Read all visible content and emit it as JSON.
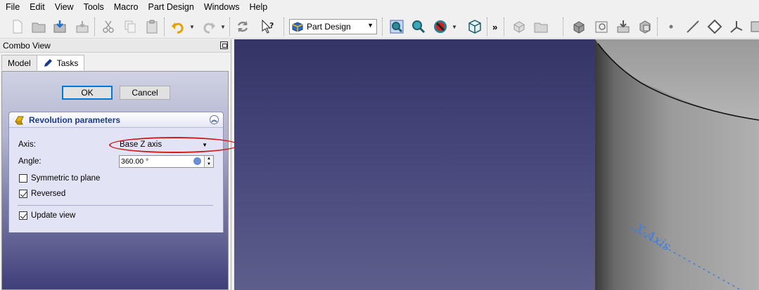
{
  "menu": [
    "File",
    "Edit",
    "View",
    "Tools",
    "Macro",
    "Part Design",
    "Windows",
    "Help"
  ],
  "toolbar": {
    "workbench_selected": "Part Design",
    "more_label": "»"
  },
  "combo_view": {
    "title": "Combo View",
    "tabs": [
      {
        "label": "Model",
        "active": false
      },
      {
        "label": "Tasks",
        "active": true
      }
    ]
  },
  "task": {
    "ok_label": "OK",
    "cancel_label": "Cancel",
    "panel_title": "Revolution parameters",
    "axis_label": "Axis:",
    "axis_value": "Base Z axis",
    "angle_label": "Angle:",
    "angle_value": "360.00 °",
    "symmetric_label": "Symmetric to plane",
    "symmetric_checked": false,
    "reversed_label": "Reversed",
    "reversed_checked": true,
    "update_view_label": "Update view",
    "update_view_checked": true
  },
  "viewport": {
    "axis_label": "X-Axis"
  },
  "colors": {
    "accent_blue": "#1b3a8c",
    "highlight_red": "#d21919",
    "viewport_top": "#343566",
    "viewport_bottom": "#5e5e8c"
  }
}
